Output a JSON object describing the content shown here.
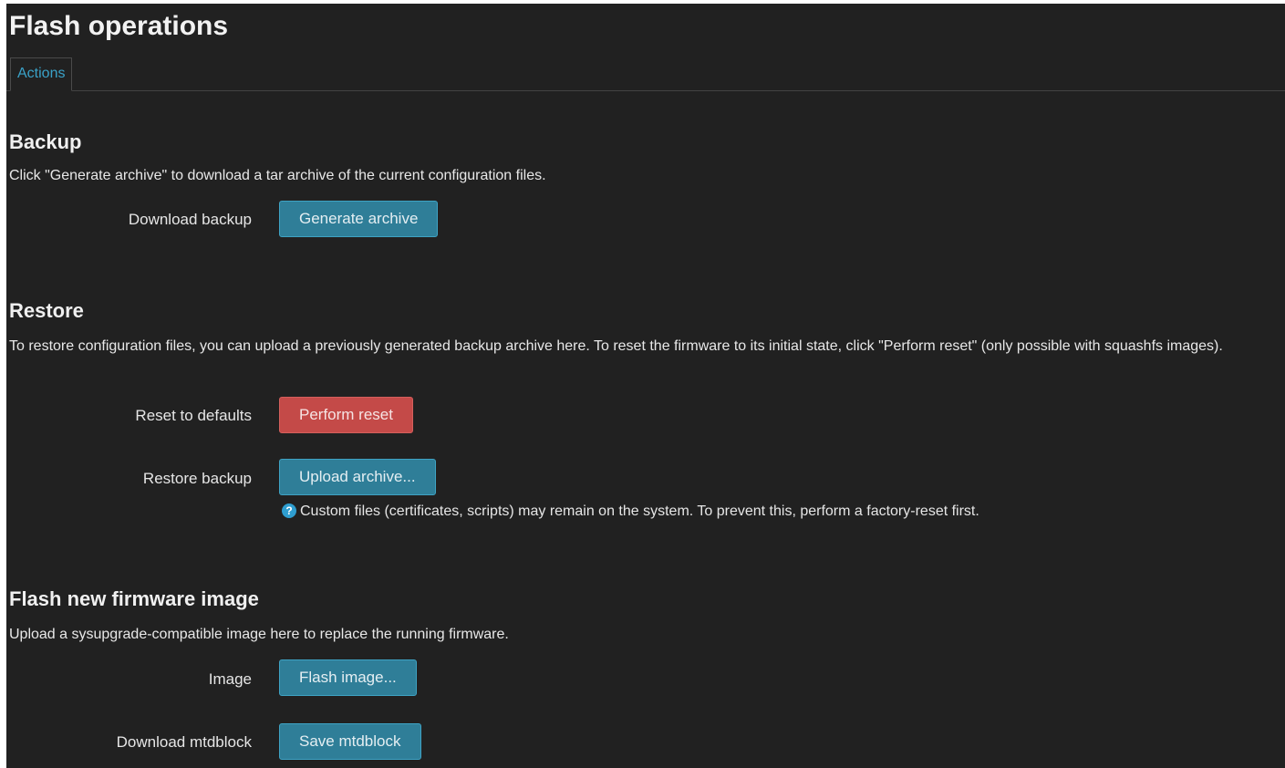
{
  "page": {
    "title": "Flash operations"
  },
  "tabs": [
    {
      "label": "Actions"
    }
  ],
  "backup": {
    "title": "Backup",
    "description": "Click \"Generate archive\" to download a tar archive of the current configuration files.",
    "download_label": "Download backup",
    "generate_button": "Generate archive"
  },
  "restore": {
    "title": "Restore",
    "description": "To restore configuration files, you can upload a previously generated backup archive here. To reset the firmware to its initial state, click \"Perform reset\" (only possible with squashfs images).",
    "reset_label": "Reset to defaults",
    "reset_button": "Perform reset",
    "restore_label": "Restore backup",
    "upload_button": "Upload archive...",
    "hint_icon": "?",
    "hint": "Custom files (certificates, scripts) may remain on the system. To prevent this, perform a factory-reset first."
  },
  "firmware": {
    "title": "Flash new firmware image",
    "description": "Upload a sysupgrade-compatible image here to replace the running firmware.",
    "image_label": "Image",
    "flash_button": "Flash image...",
    "mtd_label": "Download mtdblock",
    "save_mtd_button": "Save mtdblock"
  },
  "colors": {
    "background": "#212121",
    "primary_button": "#2f7e98",
    "danger_button": "#c44a48",
    "tab_text": "#3aa2c8",
    "help_icon": "#2f9ed0"
  }
}
